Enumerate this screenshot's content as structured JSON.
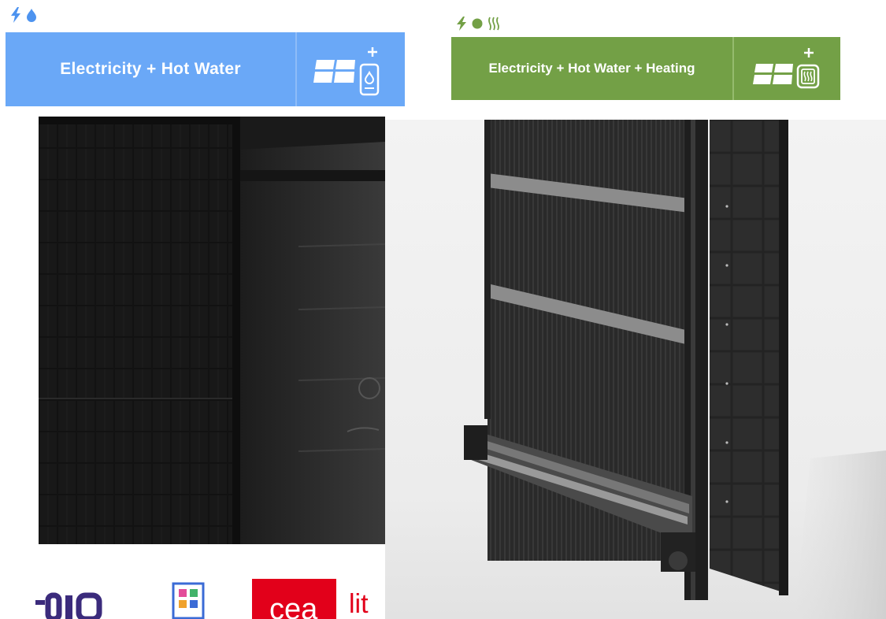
{
  "products": [
    {
      "label": "Electricity + Hot Water",
      "color": "#6aa8f7",
      "icons": [
        "lightning-icon",
        "water-drop-icon"
      ],
      "pictogram": "solar-panel-water-tank-icon"
    },
    {
      "label": "Electricity + Hot Water + Heating",
      "color": "#73a046",
      "icons": [
        "lightning-icon",
        "water-drop-icon",
        "heat-waves-icon"
      ],
      "pictogram": "solar-panel-heater-icon"
    }
  ],
  "partners": {
    "cea_logo": "cea",
    "cea_partial_text": "lit"
  },
  "colors": {
    "blue": "#6aa8f7",
    "green": "#73a046",
    "cea_red": "#e2001a"
  }
}
